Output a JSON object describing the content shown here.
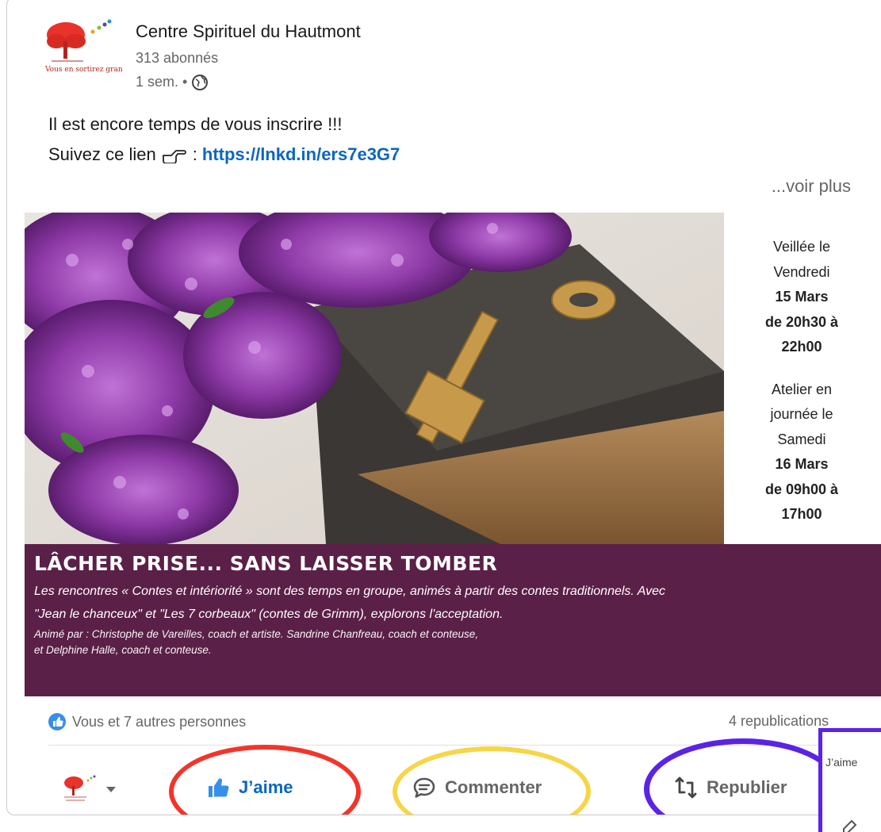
{
  "post": {
    "author": "Centre Spirituel du Hautmont",
    "followers": "313 abonnés",
    "time": "1 sem. •",
    "text_line1": "Il est encore temps de vous inscrire !!!",
    "text_line2_prefix": "Suivez ce lien",
    "text_line2_colon": ":",
    "link": "https://lnkd.in/ers7e3G7",
    "see_more": "...voir plus",
    "logo_tagline": "Vous en sortirez grandi."
  },
  "image": {
    "side": {
      "l1": "Veillée le",
      "l2": "Vendredi",
      "l3": "15 Mars",
      "l4": "de 20h30 à",
      "l5": "22h00",
      "l6": "Atelier en",
      "l7": "journée le",
      "l8": "Samedi",
      "l9": "16 Mars",
      "l10": "de 09h00 à",
      "l11": "17h00"
    },
    "banner_title": "LÂCHER PRISE... SANS LAISSER TOMBER",
    "banner_desc": "Les rencontres « Contes et intériorité » sont des temps en groupe, animés à partir des contes traditionnels. Avec \"Jean le chanceux\" et \"Les 7 corbeaux\" (contes de Grimm), explorons l'acceptation.",
    "banner_credit_1": "Animé par : Christophe de Vareilles, coach et artiste. Sandrine Chanfreau, coach et conteuse,",
    "banner_credit_2": "et Delphine Halle, coach et conteuse."
  },
  "social": {
    "reactions": "Vous et 7 autres personnes",
    "reposts": "4 republications"
  },
  "actions": {
    "like": "J’aime",
    "comment": "Commenter",
    "repost": "Republier"
  },
  "popup": {
    "label": "J’aime"
  },
  "colors": {
    "link": "#0a66c2",
    "banner": "#5b2047",
    "annotation_red": "#f2352b",
    "annotation_yellow": "#f6d547",
    "annotation_purple": "#5a23e6"
  }
}
